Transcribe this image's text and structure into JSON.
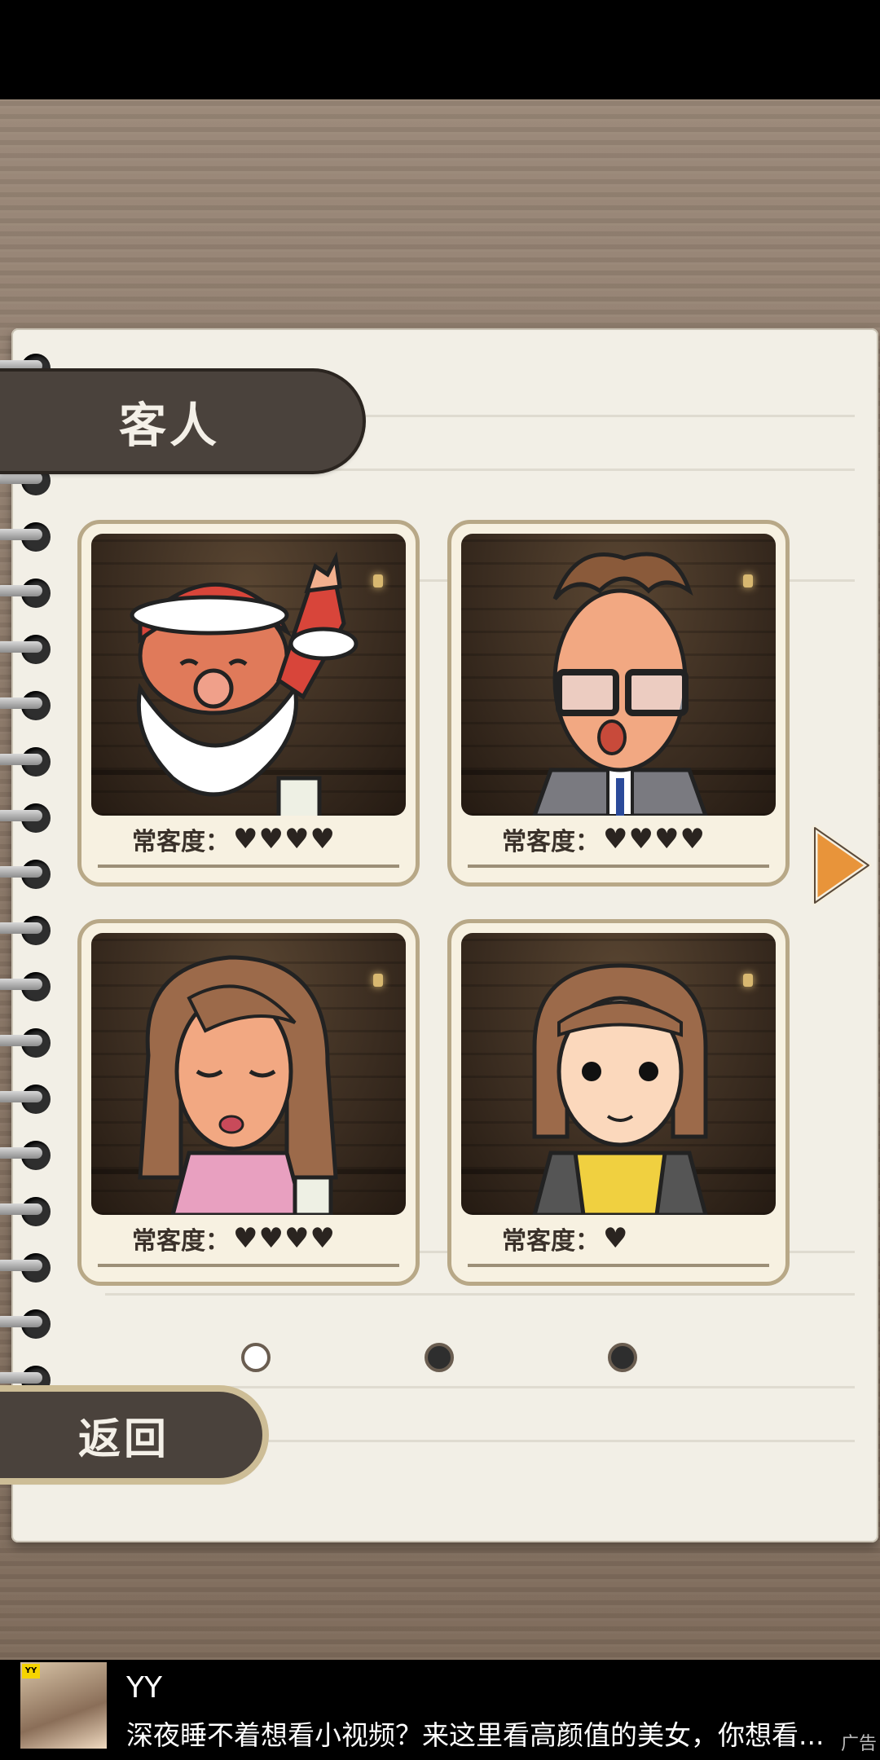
{
  "header": {
    "title": "客人"
  },
  "customers": [
    {
      "name": "santa",
      "label": "常客度：",
      "hearts": "♥♥♥♥",
      "rating": 4
    },
    {
      "name": "glasses-man",
      "label": "常客度：",
      "hearts": "♥♥♥♥",
      "rating": 4
    },
    {
      "name": "woman-long-hair",
      "label": "常客度：",
      "hearts": "♥♥♥♥",
      "rating": 4
    },
    {
      "name": "girl-yellow-vest",
      "label": "常客度：",
      "hearts": "♥",
      "rating": 1
    }
  ],
  "pagination": {
    "current": 1,
    "total": 3
  },
  "footer": {
    "back_label": "返回"
  },
  "ad": {
    "title": "YY",
    "text": "深夜睡不着想看小视频？来这里看高颜值的美女，你想看...",
    "mark": "广告",
    "badge": "YY"
  },
  "colors": {
    "accent_orange": "#e8943a",
    "tab_dark": "#4a423c",
    "paper": "#f2efe6"
  }
}
